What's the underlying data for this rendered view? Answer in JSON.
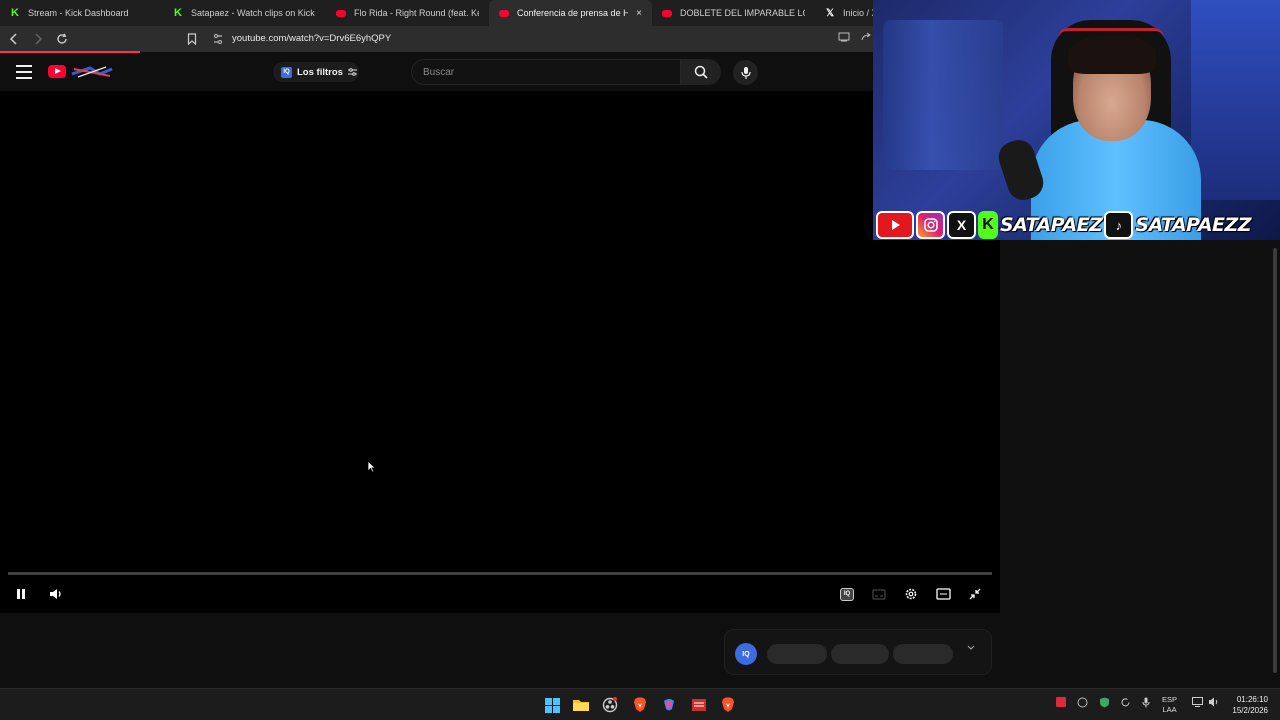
{
  "browser": {
    "tabs": [
      {
        "title": "Stream - Kick Dashboard",
        "icon": "kick-icon"
      },
      {
        "title": "Satapaez - Watch clips on Kick",
        "icon": "kick-icon"
      },
      {
        "title": "Flo Rida - Right Round (feat. Ke$ha)",
        "icon": "youtube-icon"
      },
      {
        "title": "Conferencia de prensa de Hugo",
        "icon": "youtube-icon",
        "active": true,
        "close": "×"
      },
      {
        "title": "DOBLETE DEL IMPARABLE LOCO DÍA",
        "icon": "youtube-icon"
      },
      {
        "title": "Inicio / X",
        "icon": "x-icon"
      }
    ],
    "url": "youtube.com/watch?v=Drv6E6yhQPY"
  },
  "youtube": {
    "filters_label": "Los filtros",
    "search_placeholder": "Buscar",
    "iq_badge": "IQ"
  },
  "overlay": {
    "handle_1": "SATAPAEZ",
    "handle_2": "SATAPAEZZ",
    "x_letter": "X",
    "k_letter": "K"
  },
  "taskbar": {
    "lang_1": "ESP",
    "lang_2": "LAA",
    "time": "01:26:10",
    "date": "15/2/2026"
  },
  "colors": {
    "youtube_red": "#ff0033",
    "kick_green": "#53fc18",
    "iq_blue": "#3d6be0"
  }
}
